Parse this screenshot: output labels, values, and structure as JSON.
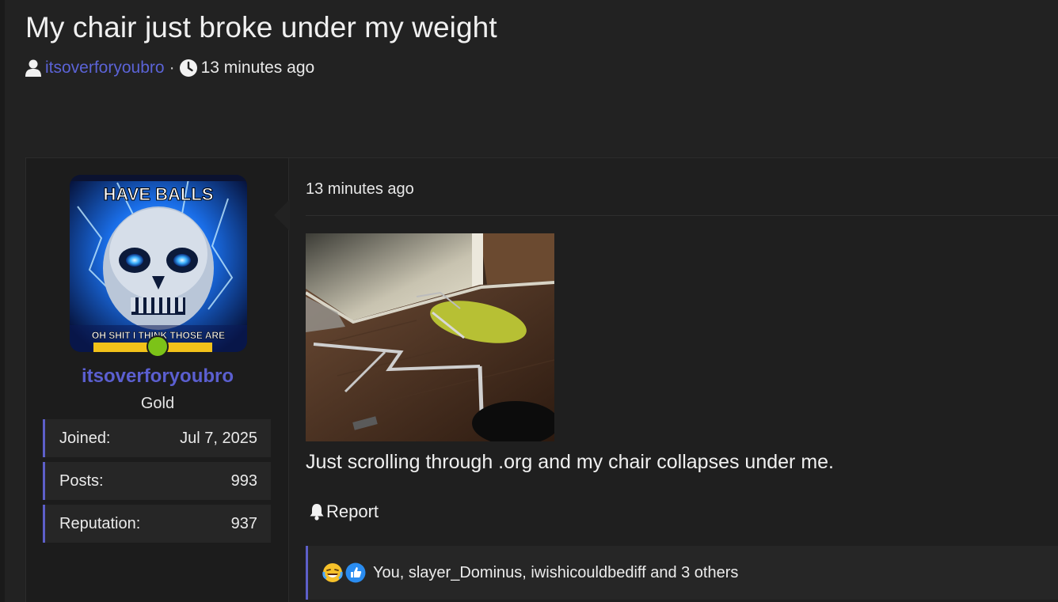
{
  "thread": {
    "title": "My chair just broke under my weight",
    "author": "itsoverforyoubro",
    "separator": "·",
    "time": "13 minutes ago"
  },
  "user": {
    "avatar_text_top": "HAVE BALLS",
    "avatar_text_bottom": "OH SHIT I THINK THOSE ARE",
    "username": "itsoverforyoubro",
    "rank": "Gold",
    "stats": [
      {
        "label": "Joined:",
        "value": "Jul 7, 2025"
      },
      {
        "label": "Posts:",
        "value": "993"
      },
      {
        "label": "Reputation:",
        "value": "937"
      }
    ],
    "online_color": "#7cc318"
  },
  "post": {
    "time": "13 minutes ago",
    "body": "Just scrolling through .org and my chair collapses under me.",
    "report_label": "Report",
    "reactions_text": "You, slayer_Dominus, iwishicouldbediff and 3 others",
    "reaction_icons": [
      "crying-laughing-emoji-icon",
      "thumbs-up-icon"
    ]
  },
  "colors": {
    "link": "#5b63d6",
    "accent": "#5d5fc9",
    "background": "#222222"
  }
}
